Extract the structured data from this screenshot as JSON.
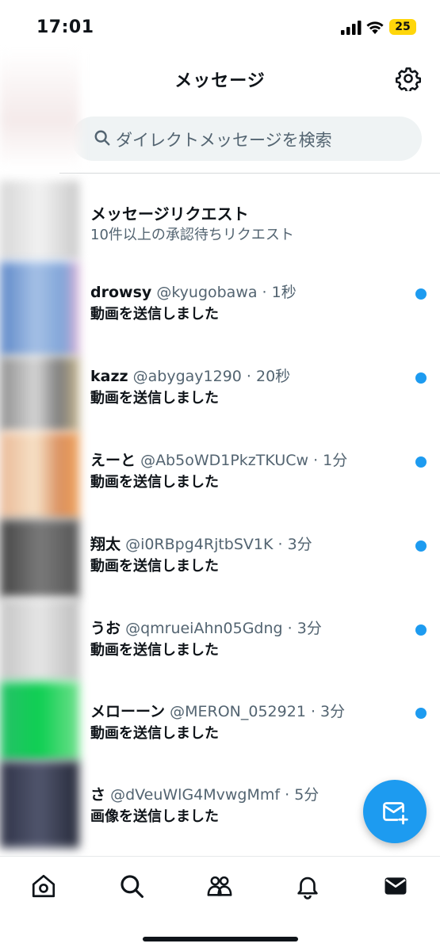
{
  "status_bar": {
    "time": "17:01",
    "battery": "25"
  },
  "header": {
    "title": "メッセージ"
  },
  "search": {
    "placeholder": "ダイレクトメッセージを検索"
  },
  "requests": {
    "title": "メッセージリクエスト",
    "subtitle": "10件以上の承認待ちリクエスト"
  },
  "conversations": [
    {
      "name": "drowsy",
      "handle": "@kyugobawa",
      "time": "1秒",
      "preview": "動画を送信しました",
      "unread": true
    },
    {
      "name": "kazz",
      "handle": "@abygay1290",
      "time": "20秒",
      "preview": "動画を送信しました",
      "unread": true
    },
    {
      "name": "えーと",
      "handle": "@Ab5oWD1PkzTKUCw",
      "time": "1分",
      "preview": "動画を送信しました",
      "unread": true
    },
    {
      "name": "翔太",
      "handle": "@i0RBpg4RjtbSV1K",
      "time": "3分",
      "preview": "動画を送信しました",
      "unread": true
    },
    {
      "name": "うお",
      "handle": "@qmrueiAhn05Gdng",
      "time": "3分",
      "preview": "動画を送信しました",
      "unread": true
    },
    {
      "name": "メローーン",
      "handle": "@MERON_052921",
      "time": "3分",
      "preview": "動画を送信しました",
      "unread": true
    },
    {
      "name": "さ",
      "handle": "@dVeuWlG4MvwgMmf",
      "time": "5分",
      "preview": "画像を送信しました",
      "unread": true
    }
  ],
  "separator": " · ",
  "colors": {
    "accent": "#1d9bf0",
    "secondary_text": "#536471",
    "battery": "#ffd60a"
  },
  "icons": {
    "status": [
      "signal-icon",
      "wifi-icon"
    ],
    "header": "gear-icon",
    "search": "search-icon",
    "fab": "new-message-icon",
    "nav": [
      "home-icon",
      "search-nav-icon",
      "communities-icon",
      "notifications-icon",
      "messages-icon"
    ]
  }
}
